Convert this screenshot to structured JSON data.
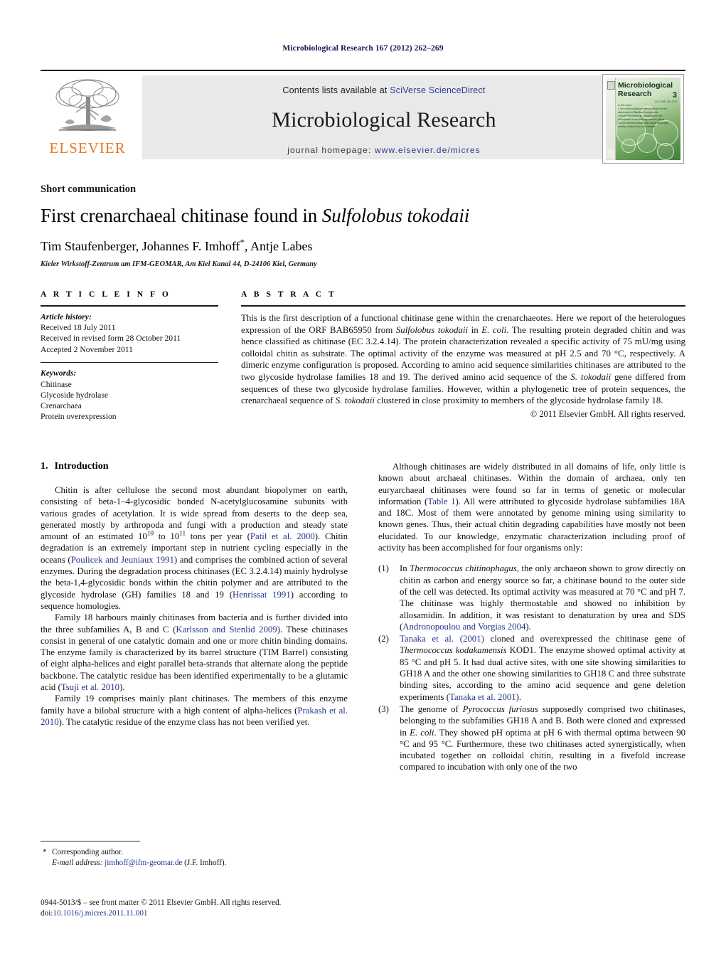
{
  "running_head": "Microbiological Research 167 (2012) 262–269",
  "masthead": {
    "contents_prefix": "Contents lists available at ",
    "contents_link": "SciVerse ScienceDirect",
    "journal_name": "Microbiological Research",
    "homepage_prefix": "journal homepage: ",
    "homepage_link": "www.elsevier.de/micres",
    "publisher_name": "ELSEVIER",
    "cover": {
      "title_line1": "Microbiological",
      "title_line2": "Research",
      "volume_number": "3",
      "volume_line": "VOLUME 166  2011",
      "issue_heading": "In this issue:",
      "issue_items": [
        "• The chitin-binding protein functions for the attachment of Bacillus thuringiensis",
        "• Novel Rhizobium sp. distributed in the rhizosphere of several leguminous plants",
        "• A new bacterial strain with broad antifungal activity isolated from soil samples"
      ]
    }
  },
  "article": {
    "doctype": "Short communication",
    "title_plain": "First crenarchaeal chitinase found in ",
    "title_italic": "Sulfolobus tokodaii",
    "authors": "Tim Staufenberger, Johannes F. Imhoff",
    "authors_tail": ", Antje Labes",
    "affiliation": "Kieler Wirkstoff-Zentrum am IFM-GEOMAR, Am Kiel Kanal 44, D-24106 Kiel, Germany"
  },
  "article_info": {
    "section_label": "A R T I C L E   I N F O",
    "history_label": "Article history:",
    "history": [
      "Received 18 July 2011",
      "Received in revised form 28 October 2011",
      "Accepted 2 November 2011"
    ],
    "keywords_label": "Keywords:",
    "keywords": [
      "Chitinase",
      "Glycoside hydrolase",
      "Crenarchaea",
      "Protein overexpression"
    ]
  },
  "abstract": {
    "section_label": "A B S T R A C T",
    "part1": "This is the first description of a functional chitinase gene within the crenarchaeotes. Here we report of the heterologues expression of the ORF BAB65950 from ",
    "organism1": "Sulfolobus tokodaii",
    "part2": " in ",
    "organism2": "E. coli",
    "part3": ". The resulting protein degraded chitin and was hence classified as chitinase (EC 3.2.4.14). The protein characterization revealed a specific activity of 75 mU/mg using colloidal chitin as substrate. The optimal activity of the enzyme was measured at pH 2.5 and 70 °C, respectively. A dimeric enzyme configuration is proposed. According to amino acid sequence similarities chitinases are attributed to the two glycoside hydrolase families 18 and 19. The derived amino acid sequence of the ",
    "organism3": "S. tokodaii",
    "part4": " gene differed from sequences of these two glycoside hydrolase families. However, within a phylogenetic tree of protein sequences, the crenarchaeal sequence of ",
    "organism4": "S. tokodaii",
    "part5": " clustered in close proximity to members of the glycoside hydrolase family 18.",
    "copyright": "© 2011 Elsevier GmbH. All rights reserved."
  },
  "introduction": {
    "heading_number": "1.",
    "heading_text": "Introduction",
    "p1_a": "Chitin is after cellulose the second most abundant biopolymer on earth, consisting of beta-1–4-glycosidic bonded N-acetylglucosamine subunits with various grades of acetylation. It is wide spread from deserts to the deep sea, generated mostly by arthropoda and fungi with a production and steady state amount of an estimated 10",
    "p1_sup1": "10",
    "p1_b": " to 10",
    "p1_sup2": "11",
    "p1_c": " tons per year (",
    "p1_cite1": "Patil et al. 2000",
    "p1_d": "). Chitin degradation is an extremely important step in nutrient cycling especially in the oceans (",
    "p1_cite2": "Poulicek and Jeuniaux 1991",
    "p1_e": ") and comprises the combined action of several enzymes. During the degradation process chitinases (EC 3.2.4.14) mainly hydrolyse the beta-1,4-glycosidic bonds within the chitin polymer and are attributed to the glycoside hydrolase (GH) families 18 and 19 (",
    "p1_cite3": "Henrissat 1991",
    "p1_f": ") according to sequence homologies.",
    "p2_a": "Family 18 harbours mainly chitinases from bacteria and is further divided into the three subfamilies A, B and C (",
    "p2_cite1": "Karlsson and Stenlid 2009",
    "p2_b": "). These chitinases consist in general of one catalytic domain and one or more chitin binding domains. The enzyme family is characterized by its barrel structure (TIM Barrel) consisting of eight alpha-helices and eight parallel beta-strands that alternate along the peptide backbone. The catalytic residue has been identified experimentally to be a glutamic acid (",
    "p2_cite2": "Tsuji et al. 2010",
    "p2_c": ").",
    "p3_a": "Family 19 comprises mainly plant chitinases. The members of this enzyme family have a bilobal structure with a high content of alpha-helices (",
    "p3_cite1": "Prakash et al. 2010",
    "p3_b": "). The catalytic residue of the enzyme class has not been verified yet."
  },
  "right_column": {
    "p1_a": "Although chitinases are widely distributed in all domains of life, only little is known about archaeal chitinases. Within the domain of archaea, only ten euryarchaeal chitinases were found so far in terms of genetic or molecular information (",
    "p1_cite1": "Table 1",
    "p1_b": "). All were attributed to glycoside hydrolase subfamilies 18A and 18C. Most of them were annotated by genome mining using similarity to known genes. Thus, their actual chitin degrading capabilities have mostly not been elucidated. To our knowledge, enzymatic characterization including proof of activity has been accomplished for four organisms only:",
    "items": [
      {
        "marker": "(1)",
        "a": "In ",
        "italic1": "Thermococcus chitinophagus",
        "b": ", the only archaeon shown to grow directly on chitin as carbon and energy source so far, a chitinase bound to the outer side of the cell was detected. Its optimal activity was measured at 70 °C and pH 7. The chitinase was highly thermostable and showed no inhibition by allosamidin. In addition, it was resistant to denaturation by urea and SDS (",
        "cite1": "Andronopoulou and Vorgias 2004",
        "c": ")."
      },
      {
        "marker": "(2)",
        "cite_lead": "Tanaka et al. (2001)",
        "a": " cloned and overexpressed the chitinase gene of ",
        "italic1": "Thermococcus kodakamensis",
        "b": " KOD1. The enzyme showed optimal activity at 85 °C and pH 5. It had dual active sites, with one site showing similarities to GH18 A and the other one showing similarities to GH18 C and three substrate binding sites, according to the amino acid sequence and gene deletion experiments (",
        "cite1": "Tanaka et al. 2001",
        "c": ")."
      },
      {
        "marker": "(3)",
        "a": "The genome of ",
        "italic1": "Pyrococcus furiosus",
        "b": " supposedly comprised two chitinases, belonging to the subfamilies GH18 A and B. Both were cloned and expressed in ",
        "italic2": "E. coli",
        "c": ". They showed pH optima at pH 6 with thermal optima between 90 °C and 95 °C. Furthermore, these two chitinases acted synergistically, when incubated together on colloidal chitin, resulting in a fivefold increase compared to incubation with only one of the two"
      }
    ]
  },
  "footnotes": {
    "corresponding_marker": "*",
    "corresponding_text": "Corresponding author.",
    "email_label": "E-mail address:",
    "email_link": "jimhoff@ifm-geomar.de",
    "email_tail": " (J.F. Imhoff).",
    "issn_line": "0944-5013/$ – see front matter © 2011 Elsevier GmbH. All rights reserved.",
    "doi_label": "doi:",
    "doi_value": "10.1016/j.micres.2011.11.001"
  },
  "colors": {
    "running_head": "#16165c",
    "link_blue": "#2b3a8f",
    "cite_blue": "#23368c",
    "elsevier_orange": "#e87722",
    "banner_grey": "#e9e9ea"
  }
}
